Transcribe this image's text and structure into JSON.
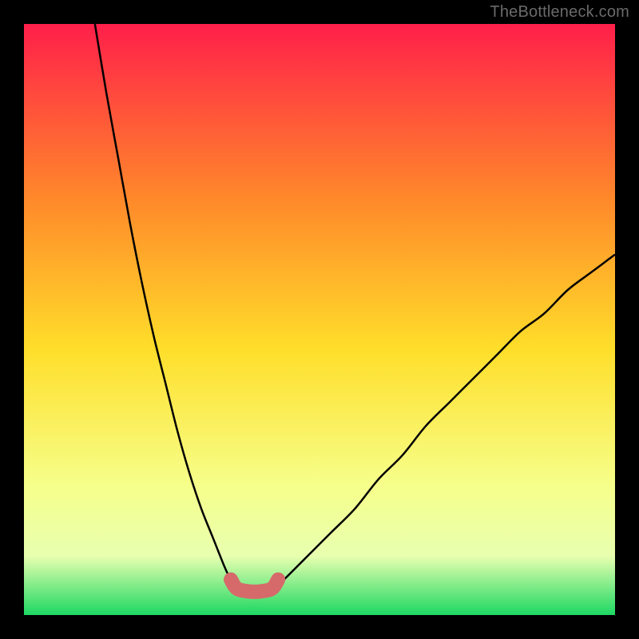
{
  "watermark": "TheBottleneck.com",
  "chart_data": {
    "type": "line",
    "title": "",
    "xlabel": "",
    "ylabel": "",
    "xlim": [
      0,
      100
    ],
    "ylim": [
      0,
      100
    ],
    "grid": false,
    "series": [
      {
        "name": "left-curve",
        "x": [
          12,
          14,
          16,
          18,
          20,
          22,
          24,
          26,
          28,
          30,
          32,
          34,
          35,
          36
        ],
        "y": [
          100,
          88,
          77,
          66,
          56,
          47,
          39,
          31,
          24,
          18,
          13,
          8,
          6,
          5
        ]
      },
      {
        "name": "right-curve",
        "x": [
          43,
          45,
          48,
          52,
          56,
          60,
          64,
          68,
          72,
          76,
          80,
          84,
          88,
          92,
          96,
          100
        ],
        "y": [
          5,
          7,
          10,
          14,
          18,
          23,
          27,
          32,
          36,
          40,
          44,
          48,
          51,
          55,
          58,
          61
        ]
      },
      {
        "name": "minimum-highlight",
        "x": [
          35,
          36,
          38,
          40,
          42,
          43
        ],
        "y": [
          6,
          4.5,
          4,
          4,
          4.5,
          6
        ]
      }
    ],
    "background_gradient": {
      "top": "#ff1f4a",
      "upper_mid": "#ff8a2a",
      "mid": "#ffde2a",
      "lower_mid": "#f6ff8a",
      "band": "#e8ffb0",
      "bottom": "#1cd862"
    },
    "highlight_color": "#d66a6a",
    "curve_color": "#000000"
  }
}
